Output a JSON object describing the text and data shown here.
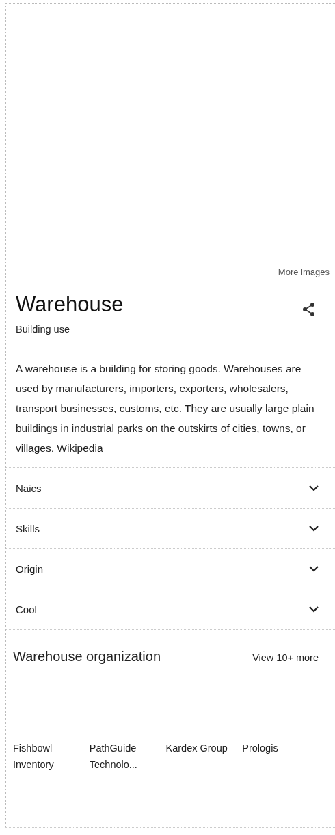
{
  "images": {
    "more_label": "More images"
  },
  "title": "Warehouse",
  "subtitle": "Building use",
  "description": "A warehouse is a building for storing goods. Warehouses are used by manufacturers, importers, exporters, wholesalers, transport businesses, customs, etc. They are usually large plain buildings in industrial parks on the outskirts of cities, towns, or villages.",
  "source": "Wikipedia",
  "attributes": [
    {
      "label": "Naics",
      "expanded": false
    },
    {
      "label": "Skills",
      "expanded": false
    },
    {
      "label": "Origin",
      "expanded": false
    },
    {
      "label": "Cool",
      "expanded": false
    }
  ],
  "related": {
    "title": "Warehouse organization",
    "more": "View 10+ more",
    "items": [
      {
        "name": "Fishbowl Inventory"
      },
      {
        "name": "PathGuide Technolo..."
      },
      {
        "name": "Kardex Group"
      },
      {
        "name": "Prologis"
      }
    ]
  }
}
